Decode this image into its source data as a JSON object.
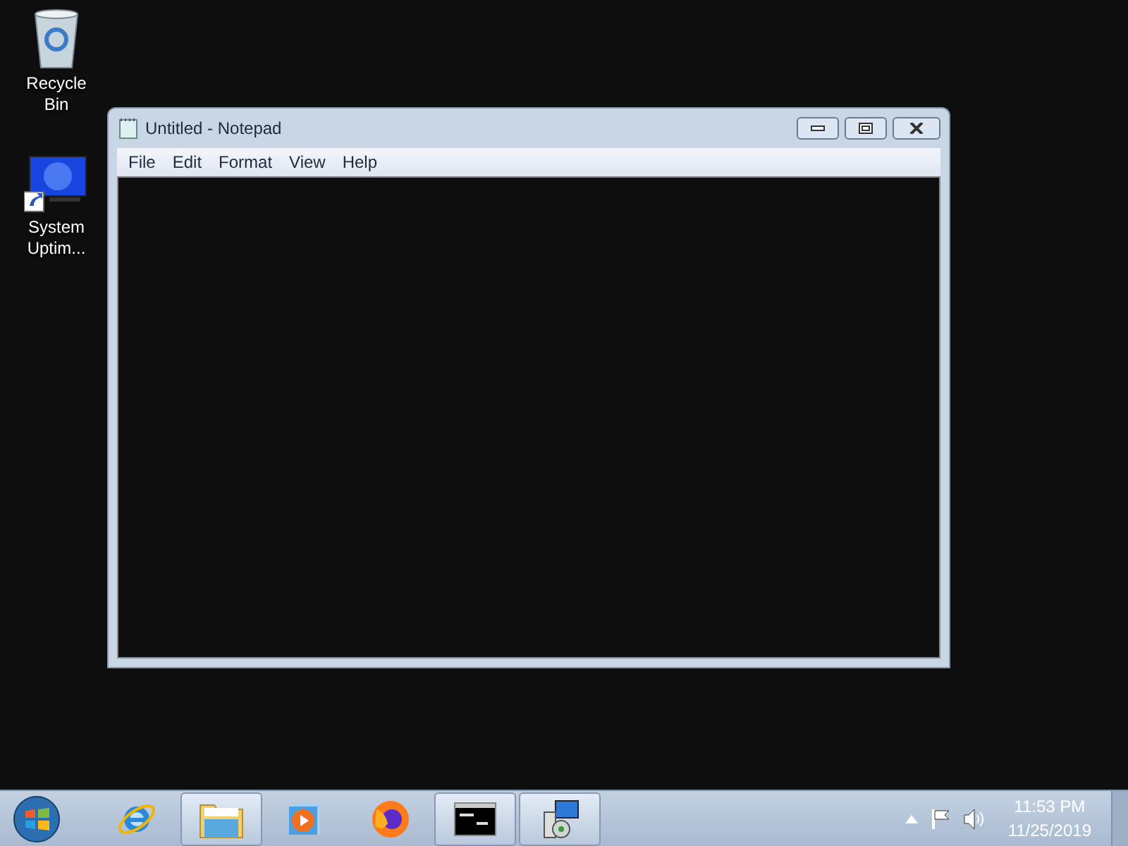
{
  "desktop_icons": [
    {
      "kind": "recycle",
      "label": "Recycle Bin"
    },
    {
      "kind": "monitor",
      "label": "System Uptim..."
    }
  ],
  "window": {
    "title": "Untitled - Notepad",
    "menu": [
      "File",
      "Edit",
      "Format",
      "View",
      "Help"
    ]
  },
  "taskbar": {
    "items": [
      {
        "kind": "ie",
        "running": false
      },
      {
        "kind": "folder",
        "running": true
      },
      {
        "kind": "media",
        "running": false
      },
      {
        "kind": "firefox",
        "running": false
      },
      {
        "kind": "console",
        "running": true
      },
      {
        "kind": "installer",
        "running": true
      }
    ],
    "time": "11:53 PM",
    "date": "11/25/2019"
  }
}
